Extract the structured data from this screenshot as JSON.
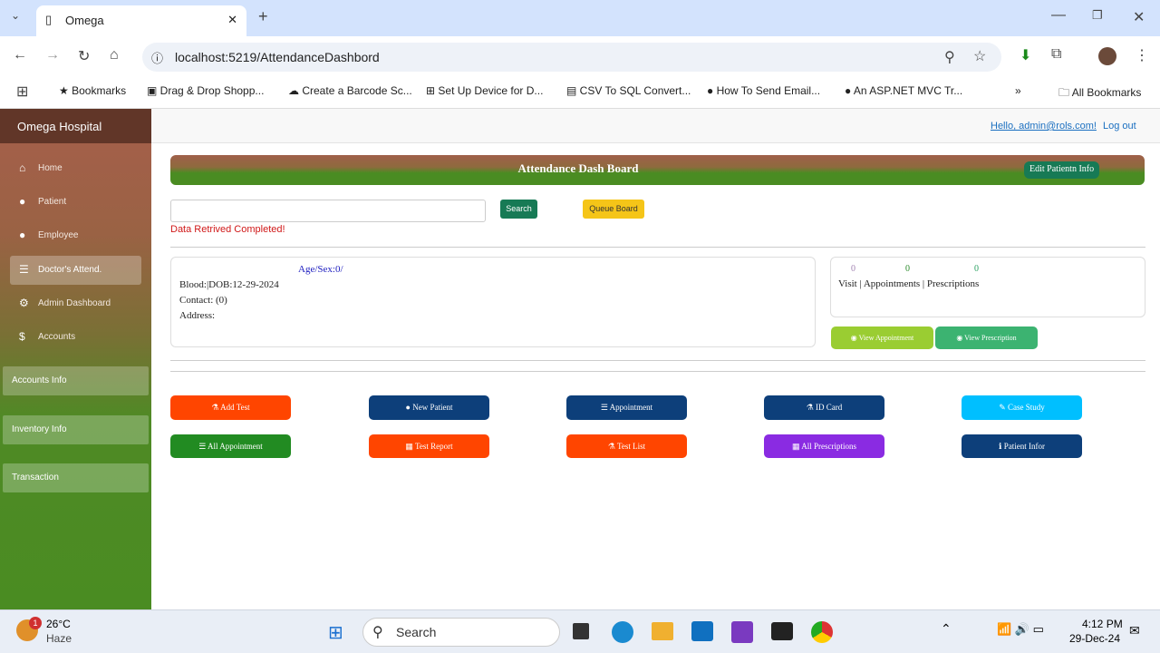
{
  "browser": {
    "tab_title": "Omega",
    "url": "localhost:5219/AttendanceDashbord",
    "bookmarks": [
      "Bookmarks",
      "Drag & Drop Shopp...",
      "Create a Barcode Sc...",
      "Set Up Device for D...",
      "CSV To SQL Convert...",
      "How To Send Email...",
      "An ASP.NET MVC Tr..."
    ],
    "all_bookmarks": "All Bookmarks"
  },
  "sidebar": {
    "brand": "Omega Hospital",
    "items": [
      {
        "label": "Home",
        "icon": "home-icon"
      },
      {
        "label": "Patient",
        "icon": "user-icon"
      },
      {
        "label": "Employee",
        "icon": "users-icon"
      },
      {
        "label": "Doctor's Attend.",
        "icon": "list-icon",
        "active": true
      },
      {
        "label": "Admin Dashboard",
        "icon": "gear-icon"
      },
      {
        "label": "Accounts",
        "icon": "dollar-icon"
      }
    ],
    "sections": [
      "Accounts Info",
      "Inventory Info",
      "Transaction"
    ]
  },
  "header": {
    "greeting": "Hello, admin@rols.com!",
    "logout": "Log out"
  },
  "banner": {
    "title": "Attendance Dash Board",
    "edit_button": "Edit Patientn Info"
  },
  "search": {
    "value": "",
    "button": "Search",
    "queue_button": "Queue Board",
    "message": "Data Retrived Completed!"
  },
  "patient": {
    "age_sex": "Age/Sex:0/",
    "blood_dob": "Blood:|DOB:12-29-2024",
    "contact": "Contact: (0)",
    "address": "Address:"
  },
  "stats": {
    "visit": "0",
    "appointments": "0",
    "prescriptions": "0",
    "label": "Visit | Appointments | Prescriptions",
    "view_appointment": "View Appointment",
    "view_prescription": "View Prescription"
  },
  "actions": [
    {
      "label": "Add Test",
      "color": "#ff4500",
      "icon": "flask-icon"
    },
    {
      "label": "New Patient",
      "color": "#0d3f7a",
      "icon": "user-icon"
    },
    {
      "label": "Appointment",
      "color": "#0d3f7a",
      "icon": "list-icon"
    },
    {
      "label": "ID Card",
      "color": "#0d3f7a",
      "icon": "flask-icon"
    },
    {
      "label": "Case Study",
      "color": "#00bfff",
      "icon": "pencil-icon"
    },
    {
      "label": "All Appointment",
      "color": "#228b22",
      "icon": "list-icon"
    },
    {
      "label": "Test Report",
      "color": "#ff4500",
      "icon": "grid-icon"
    },
    {
      "label": "Test List",
      "color": "#ff4500",
      "icon": "flask-icon"
    },
    {
      "label": "All Prescriptions",
      "color": "#8a2be2",
      "icon": "grid-icon"
    },
    {
      "label": "Patient Infor",
      "color": "#0d3f7a",
      "icon": "info-icon"
    }
  ],
  "taskbar": {
    "weather_temp": "26°C",
    "weather_desc": "Haze",
    "weather_badge": "1",
    "search": "Search",
    "time": "4:12 PM",
    "date": "29-Dec-24"
  }
}
